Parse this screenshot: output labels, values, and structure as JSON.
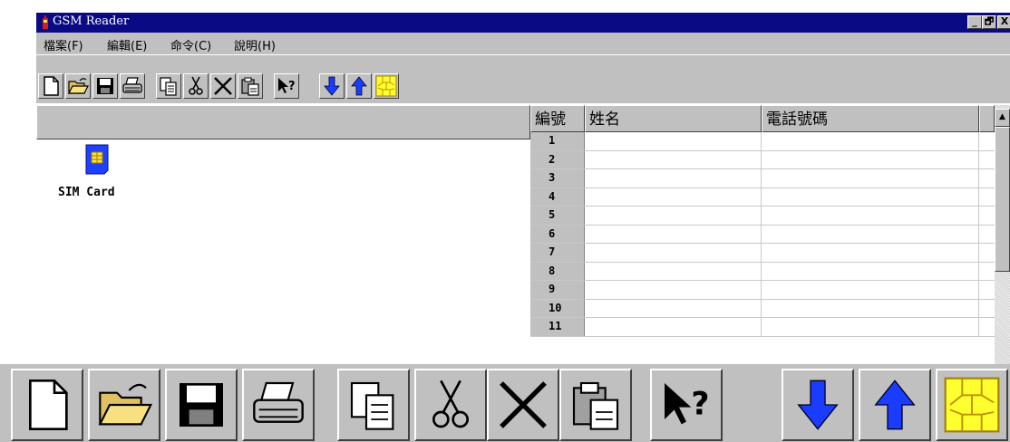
{
  "window": {
    "title": "GSM Reader",
    "controls": {
      "minimize": "_",
      "restore": "🗗",
      "close": "X"
    }
  },
  "menu": {
    "items": [
      {
        "label": "檔案(F)"
      },
      {
        "label": "編輯(E)"
      },
      {
        "label": "命令(C)"
      },
      {
        "label": "說明(H)"
      }
    ]
  },
  "toolbar": {
    "buttons": [
      {
        "icon": "new-file-icon"
      },
      {
        "icon": "open-folder-icon"
      },
      {
        "icon": "save-icon"
      },
      {
        "icon": "print-icon"
      },
      {
        "icon": "copy-icon"
      },
      {
        "icon": "cut-icon"
      },
      {
        "icon": "delete-icon"
      },
      {
        "icon": "paste-icon"
      },
      {
        "icon": "help-pointer-icon"
      },
      {
        "icon": "download-arrow-icon"
      },
      {
        "icon": "upload-arrow-icon"
      },
      {
        "icon": "sim-chip-icon"
      }
    ]
  },
  "tree": {
    "sim_label": "SIM Card"
  },
  "grid": {
    "columns": [
      "編號",
      "姓名",
      "電話號碼"
    ],
    "rows": [
      {
        "no": "1",
        "name": "",
        "phone": ""
      },
      {
        "no": "2",
        "name": "",
        "phone": ""
      },
      {
        "no": "3",
        "name": "",
        "phone": ""
      },
      {
        "no": "4",
        "name": "",
        "phone": ""
      },
      {
        "no": "5",
        "name": "",
        "phone": ""
      },
      {
        "no": "6",
        "name": "",
        "phone": ""
      },
      {
        "no": "7",
        "name": "",
        "phone": ""
      },
      {
        "no": "8",
        "name": "",
        "phone": ""
      },
      {
        "no": "9",
        "name": "",
        "phone": ""
      },
      {
        "no": "10",
        "name": "",
        "phone": ""
      },
      {
        "no": "11",
        "name": "",
        "phone": ""
      }
    ]
  },
  "colors": {
    "title_bar": "#0a0a85",
    "face": "#c0c0c0",
    "arrow_blue": "#1a3cff",
    "sim_yellow": "#ffff30"
  }
}
